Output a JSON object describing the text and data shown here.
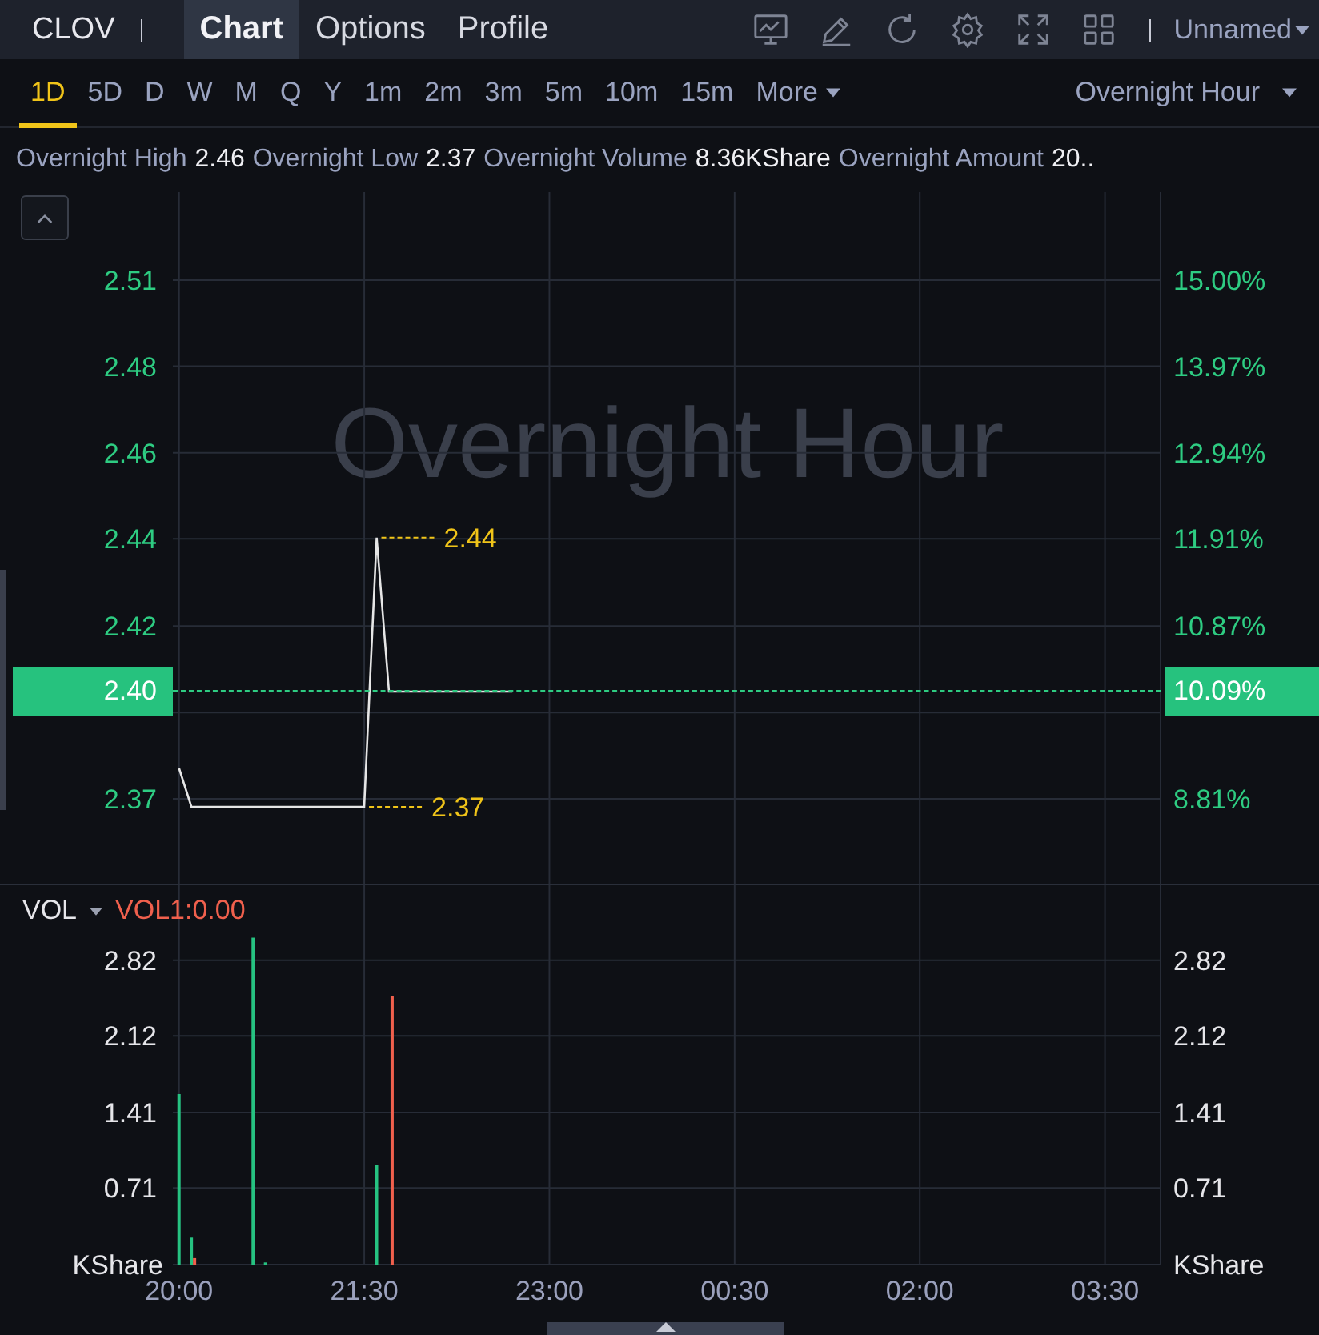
{
  "header": {
    "symbol": "CLOV",
    "tabs": [
      {
        "label": "Chart",
        "selected": true
      },
      {
        "label": "Options",
        "selected": false
      },
      {
        "label": "Profile",
        "selected": false
      }
    ],
    "layout_name": "Unnamed"
  },
  "periods": {
    "items": [
      {
        "label": "1D",
        "selected": true
      },
      {
        "label": "5D",
        "selected": false
      },
      {
        "label": "D",
        "selected": false
      },
      {
        "label": "W",
        "selected": false
      },
      {
        "label": "M",
        "selected": false
      },
      {
        "label": "Q",
        "selected": false
      },
      {
        "label": "Y",
        "selected": false
      },
      {
        "label": "1m",
        "selected": false
      },
      {
        "label": "2m",
        "selected": false
      },
      {
        "label": "3m",
        "selected": false
      },
      {
        "label": "5m",
        "selected": false
      },
      {
        "label": "10m",
        "selected": false
      },
      {
        "label": "15m",
        "selected": false
      }
    ],
    "more": "More",
    "session": "Overnight Hour"
  },
  "stats": [
    {
      "label": "Overnight High",
      "value": "2.46"
    },
    {
      "label": "Overnight Low",
      "value": "2.37"
    },
    {
      "label": "Overnight Volume",
      "value": "8.36KShare"
    },
    {
      "label": "Overnight Amount",
      "value": "20.."
    }
  ],
  "price_chart": {
    "watermark": "Overnight Hour",
    "last_price": "2.40",
    "last_percent": "10.09%",
    "right_axis": [
      "15.00%",
      "13.97%",
      "12.94%",
      "11.91%",
      "10.87%",
      "8.81%"
    ],
    "chart_data": {
      "type": "line",
      "categories": [
        null,
        null,
        null,
        null,
        null,
        null,
        null,
        null,
        null,
        null,
        null,
        null,
        null,
        null,
        null,
        null,
        null,
        null,
        null,
        null,
        null,
        null,
        null,
        null,
        null,
        null,
        null,
        null,
        null,
        null,
        null,
        null,
        null,
        null,
        null,
        null,
        null,
        null,
        null,
        null,
        null,
        null,
        null,
        null,
        null,
        null,
        null,
        null,
        null,
        null,
        null,
        null,
        null,
        null,
        null,
        null,
        null,
        null,
        null,
        null,
        null,
        null,
        null,
        null,
        null,
        null,
        null,
        null,
        null,
        null,
        null,
        null,
        null,
        null,
        null,
        null,
        null,
        null,
        null,
        null
      ],
      "series": [
        {
          "color": "#e6e6e6",
          "values": [
            2.38,
            2.37,
            2.37,
            2.37,
            2.37,
            2.37,
            2.37,
            2.37,
            2.37,
            2.37,
            2.37,
            2.37,
            2.37,
            2.37,
            2.37,
            2.37,
            2.44,
            2.4,
            2.4,
            2.4,
            2.4,
            2.4,
            2.4,
            2.4,
            2.4,
            2.4,
            2.4,
            2.4,
            null,
            null,
            null,
            null,
            null,
            null,
            null,
            null,
            null,
            null,
            null,
            null,
            null,
            null,
            null,
            null,
            null,
            null,
            null,
            null,
            null,
            null,
            null,
            null,
            null,
            null,
            null,
            null,
            null,
            null,
            null,
            null,
            null,
            null,
            null,
            null,
            null,
            null,
            null,
            null,
            null,
            null,
            null,
            null,
            null,
            null,
            null,
            null,
            null,
            null,
            null,
            null
          ]
        }
      ],
      "ylim": [
        2.3496,
        2.5299
      ],
      "yticks": [
        {
          "value": 2.507,
          "label": "2.51"
        },
        {
          "value": 2.4846,
          "label": "2.48"
        },
        {
          "value": 2.4621,
          "label": "2.46"
        },
        {
          "value": 2.4397,
          "label": "2.44"
        },
        {
          "value": 2.417,
          "label": "2.42"
        },
        {
          "value": 2.3945,
          "label": null
        },
        {
          "value": 2.3721,
          "label": "2.37"
        }
      ],
      "grid": true,
      "annotations": [
        "2.44",
        "2.37"
      ]
    }
  },
  "volume_chart": {
    "indicator": "VOL",
    "reading": "VOL1:0.00",
    "unit_left": "KShare",
    "unit_right": "KShare",
    "right_axis": [
      "2.82",
      "2.12",
      "1.41",
      "0.71"
    ],
    "chart_data": {
      "type": "bar",
      "categories": [
        "20:00",
        null,
        null,
        null,
        null,
        null,
        null,
        null,
        null,
        null,
        null,
        null,
        null,
        null,
        null,
        "21:30",
        null,
        null,
        null,
        null,
        null,
        null,
        null,
        null,
        null,
        null,
        null,
        null,
        null,
        null,
        "23:00",
        null,
        null,
        null,
        null,
        null,
        null,
        null,
        null,
        null,
        null,
        null,
        null,
        null,
        null,
        "00:30",
        null,
        null,
        null,
        null,
        null,
        null,
        null,
        null,
        null,
        null,
        null,
        null,
        null,
        null,
        "02:00",
        null,
        null,
        null,
        null,
        null,
        null,
        null,
        null,
        null,
        null,
        null,
        null,
        null,
        null,
        "03:30",
        null,
        null,
        null,
        null
      ],
      "series": [
        {
          "color": "#26c281",
          "values": [
            1.58,
            0.25,
            null,
            null,
            null,
            null,
            3.03,
            0.02,
            null,
            null,
            null,
            null,
            null,
            null,
            null,
            null,
            0.92,
            null,
            null,
            null,
            null,
            null,
            null,
            null,
            null,
            null,
            null,
            null,
            null,
            null,
            null,
            null,
            null,
            null,
            null,
            null,
            null,
            null,
            null,
            null,
            null,
            null,
            null,
            null,
            null,
            null,
            null,
            null,
            null,
            null,
            null,
            null,
            null,
            null,
            null,
            null,
            null,
            null,
            null,
            null,
            null,
            null,
            null,
            null,
            null,
            null,
            null,
            null,
            null,
            null,
            null,
            null,
            null,
            null,
            null,
            null,
            null,
            null,
            null,
            null
          ]
        },
        {
          "color": "#f0604d",
          "values": [
            null,
            0.06,
            null,
            null,
            null,
            null,
            null,
            null,
            null,
            null,
            null,
            null,
            null,
            null,
            null,
            null,
            null,
            2.49,
            null,
            null,
            null,
            null,
            null,
            null,
            null,
            null,
            null,
            null,
            null,
            null,
            null,
            null,
            null,
            null,
            null,
            null,
            null,
            null,
            null,
            null,
            null,
            null,
            null,
            null,
            null,
            null,
            null,
            null,
            null,
            null,
            null,
            null,
            null,
            null,
            null,
            null,
            null,
            null,
            null,
            null,
            null,
            null,
            null,
            null,
            null,
            null,
            null,
            null,
            null,
            null,
            null,
            null,
            null,
            null,
            null,
            null,
            null,
            null,
            null,
            null
          ]
        }
      ],
      "ylim": [
        0,
        3.516
      ],
      "grid": true,
      "yticks": [
        {
          "value": 2.82,
          "label": "2.82"
        },
        {
          "value": 2.12,
          "label": "2.12"
        },
        {
          "value": 1.41,
          "label": "1.41"
        },
        {
          "value": 0.71,
          "label": "0.71"
        }
      ]
    }
  }
}
